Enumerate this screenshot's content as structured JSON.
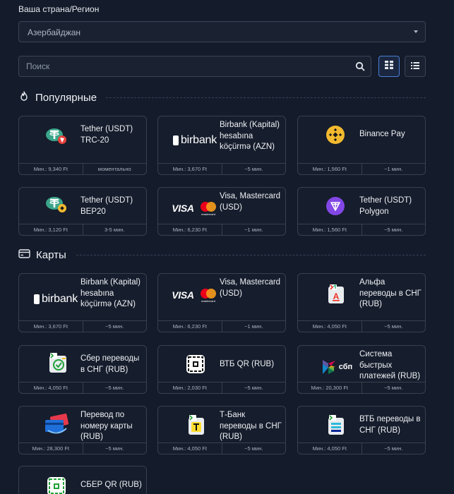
{
  "region": {
    "label": "Ваша страна/Регион",
    "value": "Азербайджан"
  },
  "search": {
    "placeholder": "Поиск"
  },
  "sections": {
    "popular": "Популярные",
    "cards": "Карты"
  },
  "popular": [
    {
      "name": "Tether (USDT) TRC-20",
      "icon": "tether-trc20-icon",
      "min": "Мин.: 9,340 Ft",
      "time": "моментально"
    },
    {
      "name": "Birbank (Kapital) hesabına köçürmə (AZN)",
      "icon": "birbank-logo",
      "logo_text": "birbank",
      "min": "Мин.: 3,670 Ft",
      "time": "~5 мин."
    },
    {
      "name": "Binance Pay",
      "icon": "binance-icon",
      "min": "Мин.: 1,560 Ft",
      "time": "~1 мин."
    },
    {
      "name": "Tether (USDT) BEP20",
      "icon": "tether-bep20-icon",
      "min": "Мин.: 3,120 Ft",
      "time": "3-5 мин."
    },
    {
      "name": "Visa, Mastercard (USD)",
      "icon": "visa-mastercard-logo",
      "logo_text": "VISA",
      "mc_text": "mastercard",
      "min": "Мин.: 6,230 Ft",
      "time": "~1 мин."
    },
    {
      "name": "Tether (USDT) Polygon",
      "icon": "tether-polygon-icon",
      "min": "Мин.: 1,560 Ft",
      "time": "~5 мин."
    }
  ],
  "cards": [
    {
      "name": "Birbank (Kapital) hesabına köçürmə (AZN)",
      "icon": "birbank-logo",
      "logo_text": "birbank",
      "min": "Мин.: 3,670 Ft",
      "time": "~5 мин."
    },
    {
      "name": "Visa, Mastercard (USD)",
      "icon": "visa-mastercard-logo",
      "logo_text": "VISA",
      "mc_text": "mastercard",
      "min": "Мин.: 6,230 Ft",
      "time": "~1 мин."
    },
    {
      "name": "Альфа переводы в СНГ (RUB)",
      "icon": "alfa-transfer-icon",
      "min": "Мин.: 4,050 Ft",
      "time": "~5 мин."
    },
    {
      "name": "Сбер переводы в СНГ (RUB)",
      "icon": "sber-transfer-icon",
      "min": "Мин.: 4,050 Ft",
      "time": "~5 мин."
    },
    {
      "name": "ВТБ QR (RUB)",
      "icon": "vtb-qr-icon",
      "min": "Мин.: 2,030 Ft",
      "time": "~5 мин."
    },
    {
      "name": "Система быстрых платежей (RUB)",
      "icon": "sbp-logo",
      "logo_text": "сбп",
      "min": "Мин.: 20,300 Ft",
      "time": "~5 мин."
    },
    {
      "name": "Перевод по номеру карты (RUB)",
      "icon": "card-transfer-icon",
      "min": "Мин.: 28,300 Ft",
      "time": "~5 мин."
    },
    {
      "name": "Т-Банк переводы в СНГ (RUB)",
      "icon": "tbank-transfer-icon",
      "min": "Мин.: 4,050 Ft",
      "time": "~5 мин."
    },
    {
      "name": "ВТБ переводы в СНГ (RUB)",
      "icon": "vtb-transfer-icon",
      "min": "Мин.: 4,050 Ft",
      "time": "~5 мин."
    },
    {
      "name": "СБЕР QR (RUB)",
      "icon": "sber-qr-icon"
    }
  ]
}
